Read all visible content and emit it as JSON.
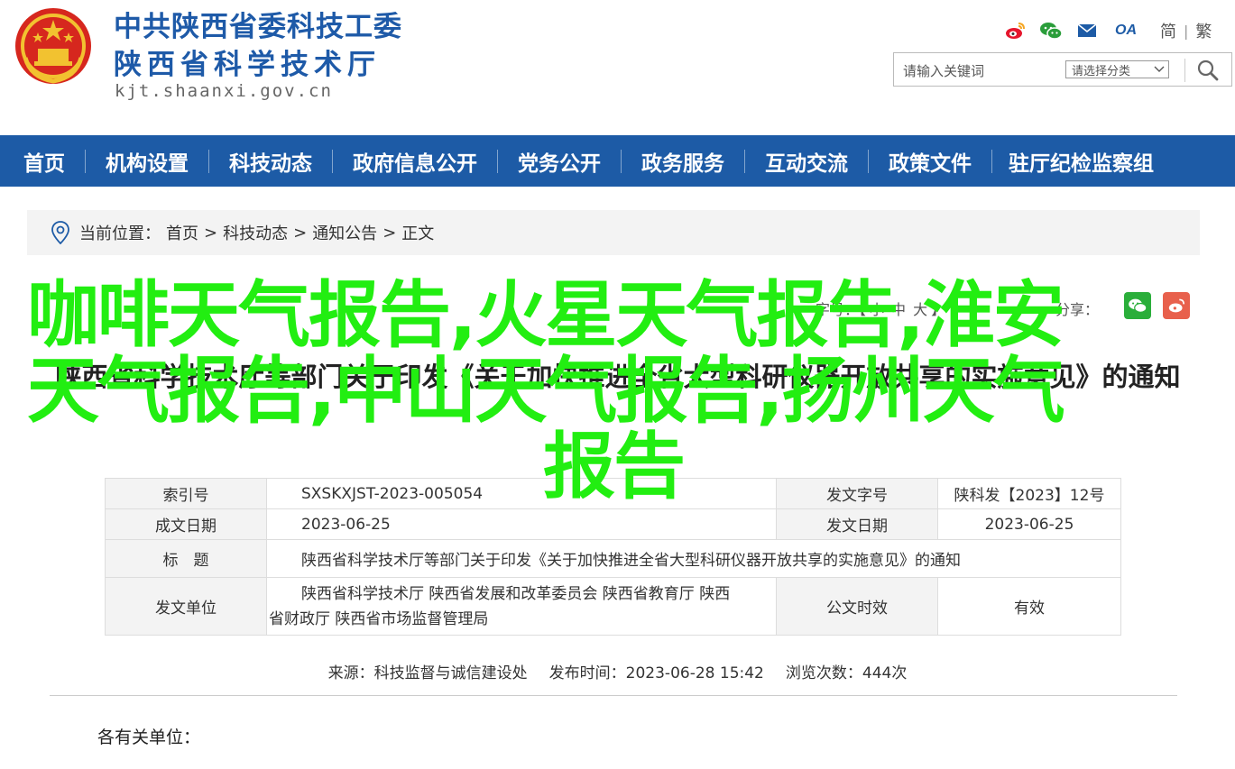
{
  "header": {
    "org_name": "中共陕西省委科技工委",
    "dept_name": "陕西省科学技术厅",
    "domain": "kjt.shaanxi.gov.cn",
    "lang_simplified": "简",
    "lang_separator": "|",
    "lang_traditional": "繁",
    "tool_icons": [
      "weibo-icon",
      "wechat-icon",
      "mail-icon",
      "oa-icon"
    ],
    "oa_label": "OA",
    "search": {
      "placeholder": "请输入关键词",
      "category_label": "请选择分类"
    }
  },
  "nav": {
    "items": [
      "首页",
      "机构设置",
      "科技动态",
      "政府信息公开",
      "党务公开",
      "政务服务",
      "互动交流",
      "政策文件",
      "驻厅纪检监察组"
    ]
  },
  "breadcrumb": {
    "label": "当前位置：",
    "items": [
      "首页",
      "科技动态",
      "通知公告",
      "正文"
    ],
    "separator": ">"
  },
  "article_tools": {
    "font_label": "字号：",
    "font_small": "小",
    "font_medium": "中",
    "font_large": "大",
    "bracket_open": "【",
    "bracket_close": "】",
    "share_label": "分享："
  },
  "article": {
    "title": "陕西省科学技术厅等部门关于印发《关于加快推进全省大型科研仪器开放共享的实施意见》的通知"
  },
  "overlay": {
    "line1": "咖啡天气报告,火星天气报告,淮安",
    "line2": "天气报告,中山天气报告,扬州天气",
    "line3": "报告"
  },
  "meta": {
    "index_no_label": "索引号",
    "index_no": "SXSKXJST-2023-005054",
    "doc_no_label": "发文字号",
    "doc_no": "陕科发【2023】12号",
    "written_date_label": "成文日期",
    "written_date": "2023-06-25",
    "issue_date_label": "发文日期",
    "issue_date": "2023-06-25",
    "title_label": "标　题",
    "title_value": "陕西省科学技术厅等部门关于印发《关于加快推进全省大型科研仪器开放共享的实施意见》的通知",
    "issuer_label": "发文单位",
    "issuer_line1": "陕西省科学技术厅 陕西省发展和改革委员会 陕西省教育厅 陕西",
    "issuer_line2": "省财政厅 陕西省市场监督管理局",
    "validity_label": "公文时效",
    "validity": "有效"
  },
  "publish": {
    "source_label": "来源：",
    "source": "科技监督与诚信建设处",
    "time_label": "发布时间：",
    "time": "2023-06-28 15:42",
    "views_label": "浏览次数：",
    "views": "444次"
  },
  "body": {
    "salutation": "各有关单位："
  },
  "colors": {
    "brand_blue": "#1d5ba6",
    "overlay_green": "#22ee11",
    "breadcrumb_bg": "#f3f3f3"
  }
}
